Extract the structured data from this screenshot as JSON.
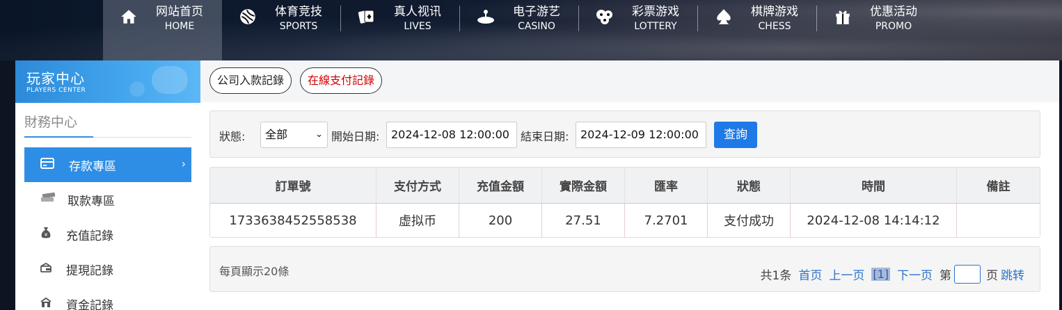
{
  "nav": [
    {
      "cn": "网站首页",
      "en": "HOME",
      "icon": "home-icon",
      "active": true
    },
    {
      "cn": "体育竞技",
      "en": "SPORTS",
      "icon": "ball-icon"
    },
    {
      "cn": "真人视讯",
      "en": "LIVES",
      "icon": "cards-icon"
    },
    {
      "cn": "电子游艺",
      "en": "CASINO",
      "icon": "joystick-icon"
    },
    {
      "cn": "彩票游戏",
      "en": "LOTTERY",
      "icon": "lottery-balls-icon"
    },
    {
      "cn": "棋牌游戏",
      "en": "CHESS",
      "icon": "spade-icon"
    },
    {
      "cn": "优惠活动",
      "en": "PROMO",
      "icon": "gift-icon"
    }
  ],
  "sidebar": {
    "banner_cn": "玩家中心",
    "banner_en": "PLAYERS CENTER",
    "section": "財務中心",
    "items": [
      {
        "label": "存款專區",
        "icon": "wallet-icon",
        "active": true
      },
      {
        "label": "取款專區",
        "icon": "cash-icon"
      },
      {
        "label": "充值記錄",
        "icon": "money-bag-icon"
      },
      {
        "label": "提現記錄",
        "icon": "withdraw-icon"
      },
      {
        "label": "資金記錄",
        "icon": "records-icon"
      }
    ]
  },
  "tabs": [
    {
      "label": "公司入款記錄"
    },
    {
      "label": "在線支付記錄"
    }
  ],
  "filter": {
    "status_label": "狀態:",
    "status_value": "全部",
    "start_label": "開始日期:",
    "start_value": "2024-12-08 12:00:00",
    "end_label": "結束日期:",
    "end_value": "2024-12-09 12:00:00",
    "search_button": "查詢"
  },
  "table": {
    "headers": [
      "訂單號",
      "支付方式",
      "充值金額",
      "實際金額",
      "匯率",
      "狀態",
      "時間",
      "備註"
    ],
    "rows": [
      [
        "1733638452558538",
        "虚拟币",
        "200",
        "27.51",
        "7.2701",
        "支付成功",
        "2024-12-08 14:14:12",
        ""
      ]
    ]
  },
  "footer": {
    "page_size": "每頁顯示20條",
    "total": "共1条",
    "first": "首页",
    "prev": "上一页",
    "current": "[1]",
    "next": "下一页",
    "page_prefix": "第",
    "page_suffix": "页",
    "jump": "跳转"
  },
  "colors": {
    "accent": "#2e8ee6",
    "tab_active_text": "#d10000",
    "button": "#1f7ae8"
  }
}
